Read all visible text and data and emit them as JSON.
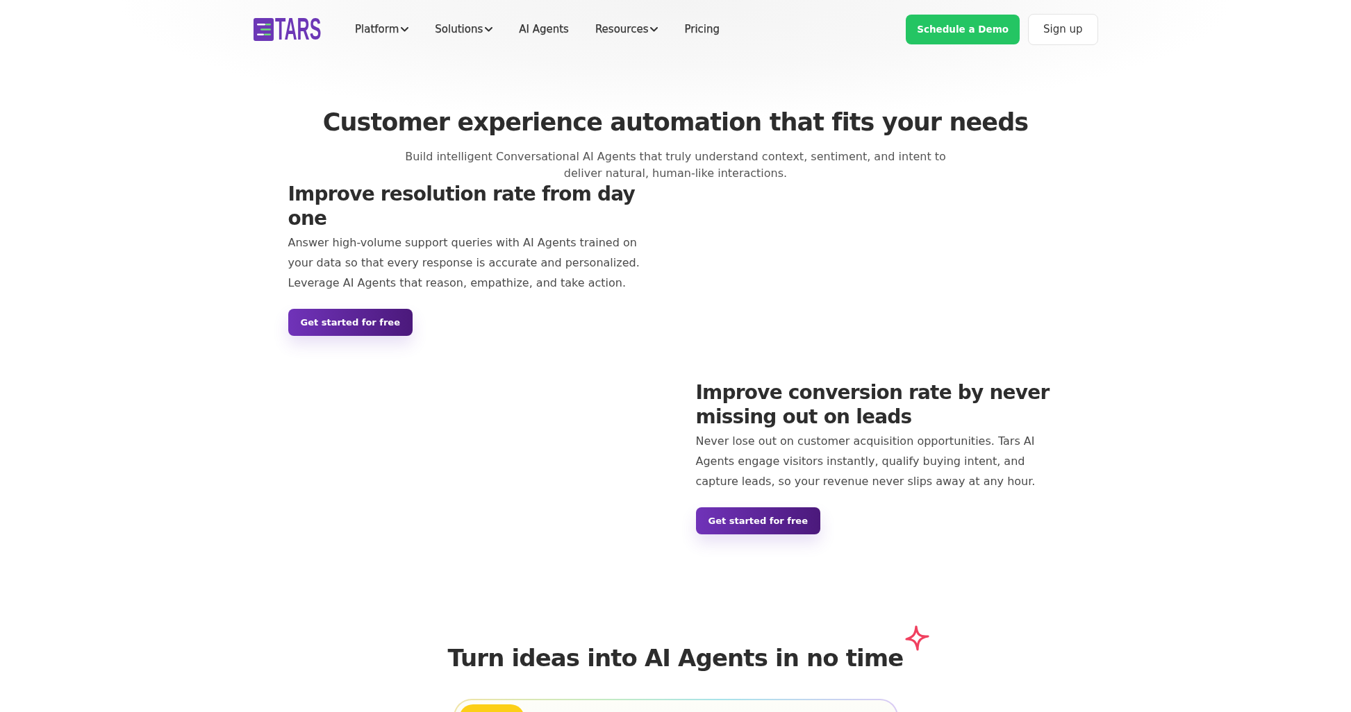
{
  "header": {
    "logo": "TARS",
    "nav": [
      {
        "label": "Platform",
        "dropdown": true
      },
      {
        "label": "Solutions",
        "dropdown": true
      },
      {
        "label": "AI Agents",
        "dropdown": false
      },
      {
        "label": "Resources",
        "dropdown": true
      },
      {
        "label": "Pricing",
        "dropdown": false
      }
    ],
    "actions": [
      {
        "label": "Schedule a Demo",
        "kind": "primary"
      },
      {
        "label": "Sign up",
        "kind": "secondary"
      }
    ]
  },
  "hero": {
    "title": "Customer experience automation that fits your needs",
    "subtitle": "Build intelligent Conversational AI Agents that truly understand context, sentiment, and intent to deliver natural, human-like interactions."
  },
  "features": [
    {
      "title": "Improve resolution rate from day one",
      "description": "Answer high-volume support queries with AI Agents trained on your data so that every response is accurate and personalized. Leverage AI Agents that reason, empathize, and take action.",
      "button": "Get started for free"
    },
    {
      "title": "Improve conversion rate by never missing out on leads",
      "description": "Never lose out on customer acquisition opportunities. Tars AI Agents engage visitors instantly, qualify buying intent, and capture leads, so your revenue never slips away at any hour.",
      "button": "Get started for free"
    }
  ],
  "showcase": {
    "title": "Turn ideas into AI Agents in no time"
  }
}
